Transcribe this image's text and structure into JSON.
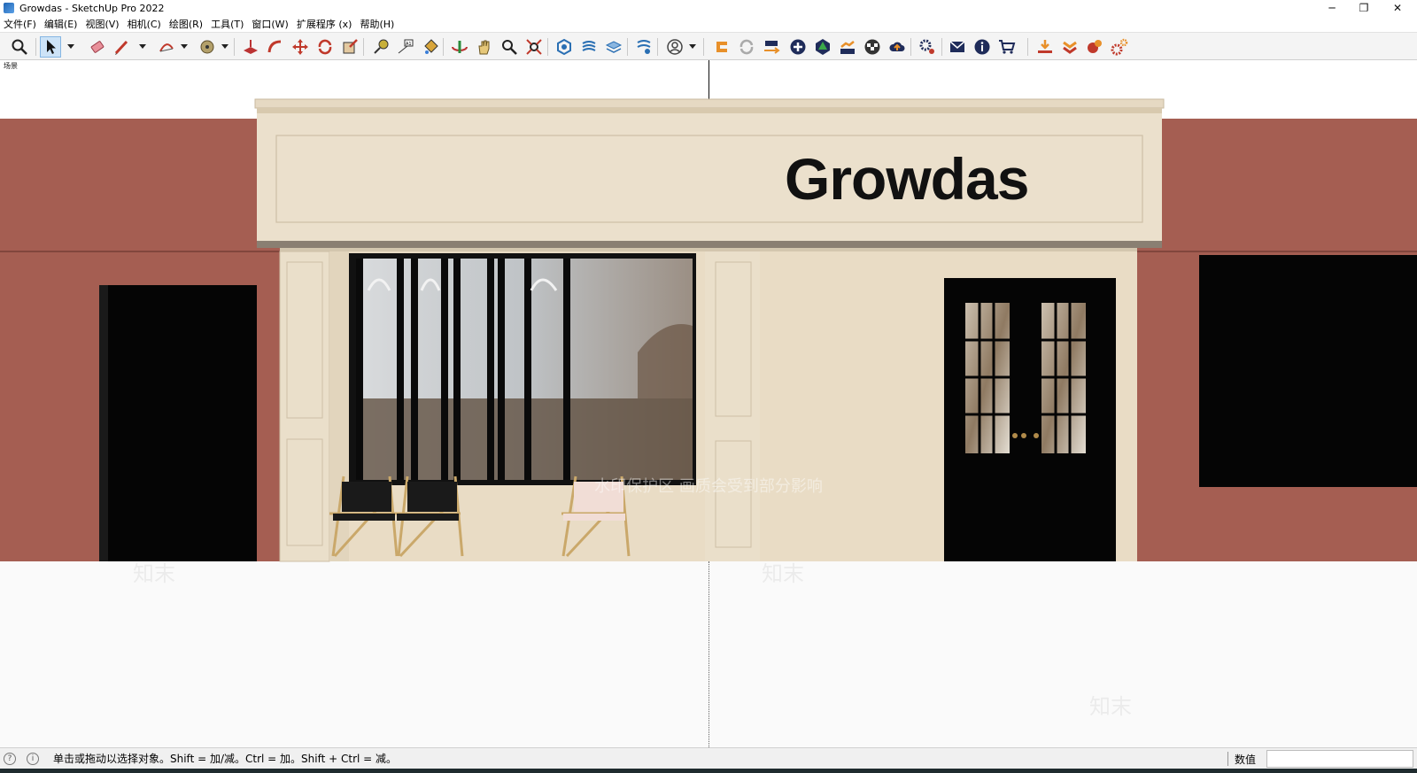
{
  "window": {
    "title": "Growdas - SketchUp Pro 2022",
    "controls": {
      "minimize": "─",
      "restore": "❐",
      "close": "✕"
    }
  },
  "menu": [
    "文件(F)",
    "编辑(E)",
    "视图(V)",
    "相机(C)",
    "绘图(R)",
    "工具(T)",
    "窗口(W)",
    "扩展程序 (x)",
    "帮助(H)"
  ],
  "viewport": {
    "scene_tab": "场景",
    "sign_text": "Growdas",
    "watermark_banner": "水印保护区 画质会受到部分影响",
    "watermark_logo": "知末"
  },
  "colors": {
    "wall_terracotta": "#a55e52",
    "facade_cream": "#e9dcc5",
    "door_black": "#050505",
    "ground": "#fafafa",
    "accent_blue": "#cde3f7"
  },
  "statusbar": {
    "hint": "单击或拖动以选择对象。Shift = 加/减。Ctrl = 加。Shift + Ctrl = 减。",
    "measurements_label": "数值",
    "measurements_value": ""
  }
}
